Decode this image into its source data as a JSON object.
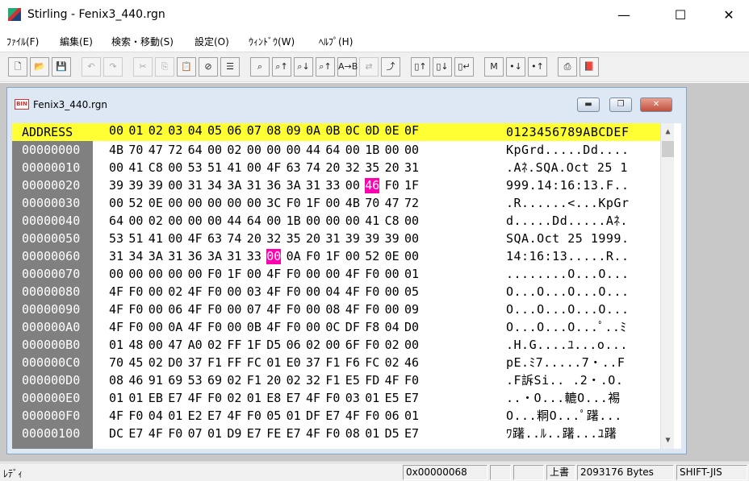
{
  "window": {
    "title": "Stirling - Fenix3_440.rgn",
    "minimize": "—",
    "maximize": "☐",
    "close": "✕"
  },
  "menu": [
    "ﾌｧｲﾙ(F)",
    "編集(E)",
    "検索・移動(S)",
    "設定(O)",
    "ｳｨﾝﾄﾞｳ(W)",
    "ﾍﾙﾌﾟ(H)"
  ],
  "toolbar": [
    {
      "name": "new-file",
      "g": "🗋",
      "d": false
    },
    {
      "name": "open",
      "g": "📂",
      "d": false
    },
    {
      "name": "save",
      "g": "💾",
      "d": false
    },
    {
      "name": "undo",
      "g": "↶",
      "d": true
    },
    {
      "name": "redo",
      "g": "↷",
      "d": true
    },
    {
      "name": "cut",
      "g": "✂",
      "d": true
    },
    {
      "name": "copy",
      "g": "⎘",
      "d": true
    },
    {
      "name": "paste",
      "g": "📋",
      "d": false
    },
    {
      "name": "delete",
      "g": "⊘",
      "d": false
    },
    {
      "name": "list",
      "g": "☰",
      "d": false
    },
    {
      "name": "find",
      "g": "⌕",
      "d": false
    },
    {
      "name": "find-next",
      "g": "⌕↑",
      "d": false
    },
    {
      "name": "find-down",
      "g": "⌕↓",
      "d": false
    },
    {
      "name": "find-up",
      "g": "⌕↑",
      "d": false
    },
    {
      "name": "replace",
      "g": "A→B",
      "d": false
    },
    {
      "name": "compare",
      "g": "⇄",
      "d": true
    },
    {
      "name": "goto",
      "g": "⤴",
      "d": false
    },
    {
      "name": "page-up",
      "g": "▯↑",
      "d": false
    },
    {
      "name": "page-down",
      "g": "▯↓",
      "d": false
    },
    {
      "name": "page-enter",
      "g": "▯↵",
      "d": false
    },
    {
      "name": "mark",
      "g": "M",
      "d": false
    },
    {
      "name": "mark-next",
      "g": "•↓",
      "d": false
    },
    {
      "name": "mark-prev",
      "g": "•↑",
      "d": false
    },
    {
      "name": "print",
      "g": "⎙",
      "d": false
    },
    {
      "name": "help",
      "g": "📕",
      "d": false
    }
  ],
  "document": {
    "title": "Fenix3_440.rgn",
    "icon_text": "BIN",
    "min": "▬",
    "restore": "❐",
    "close": "✕"
  },
  "hex": {
    "header_address": "ADDRESS",
    "header_cols": [
      "00",
      "01",
      "02",
      "03",
      "04",
      "05",
      "06",
      "07",
      "08",
      "09",
      "0A",
      "0B",
      "0C",
      "0D",
      "0E",
      "0F"
    ],
    "header_ascii": "0123456789ABCDEF",
    "rows": [
      {
        "addr": "00000000",
        "bytes": [
          "4B",
          "70",
          "47",
          "72",
          "64",
          "00",
          "02",
          "00",
          "00",
          "00",
          "44",
          "64",
          "00",
          "1B",
          "00",
          "00"
        ],
        "ascii": "KpGrd.....Dd...."
      },
      {
        "addr": "00000010",
        "bytes": [
          "00",
          "41",
          "C8",
          "00",
          "53",
          "51",
          "41",
          "00",
          "4F",
          "63",
          "74",
          "20",
          "32",
          "35",
          "20",
          "31"
        ],
        "ascii": ".Aﾈ.SQA.Oct 25 1"
      },
      {
        "addr": "00000020",
        "bytes": [
          "39",
          "39",
          "39",
          "00",
          "31",
          "34",
          "3A",
          "31",
          "36",
          "3A",
          "31",
          "33",
          "00",
          "46",
          "F0",
          "1F"
        ],
        "ascii": "999.14:16:13.F.."
      },
      {
        "addr": "00000030",
        "bytes": [
          "00",
          "52",
          "0E",
          "00",
          "00",
          "00",
          "00",
          "00",
          "3C",
          "F0",
          "1F",
          "00",
          "4B",
          "70",
          "47",
          "72"
        ],
        "ascii": ".R......<...KpGr"
      },
      {
        "addr": "00000040",
        "bytes": [
          "64",
          "00",
          "02",
          "00",
          "00",
          "00",
          "44",
          "64",
          "00",
          "1B",
          "00",
          "00",
          "00",
          "41",
          "C8",
          "00"
        ],
        "ascii": "d.....Dd.....Aﾈ."
      },
      {
        "addr": "00000050",
        "bytes": [
          "53",
          "51",
          "41",
          "00",
          "4F",
          "63",
          "74",
          "20",
          "32",
          "35",
          "20",
          "31",
          "39",
          "39",
          "39",
          "00"
        ],
        "ascii": "SQA.Oct 25 1999."
      },
      {
        "addr": "00000060",
        "bytes": [
          "31",
          "34",
          "3A",
          "31",
          "36",
          "3A",
          "31",
          "33",
          "00",
          "0A",
          "F0",
          "1F",
          "00",
          "52",
          "0E",
          "00"
        ],
        "ascii": "14:16:13.....R.."
      },
      {
        "addr": "00000070",
        "bytes": [
          "00",
          "00",
          "00",
          "00",
          "00",
          "F0",
          "1F",
          "00",
          "4F",
          "F0",
          "00",
          "00",
          "4F",
          "F0",
          "00",
          "01"
        ],
        "ascii": "........O...O..."
      },
      {
        "addr": "00000080",
        "bytes": [
          "4F",
          "F0",
          "00",
          "02",
          "4F",
          "F0",
          "00",
          "03",
          "4F",
          "F0",
          "00",
          "04",
          "4F",
          "F0",
          "00",
          "05"
        ],
        "ascii": "O...O...O...O..."
      },
      {
        "addr": "00000090",
        "bytes": [
          "4F",
          "F0",
          "00",
          "06",
          "4F",
          "F0",
          "00",
          "07",
          "4F",
          "F0",
          "00",
          "08",
          "4F",
          "F0",
          "00",
          "09"
        ],
        "ascii": "O...O...O...O..."
      },
      {
        "addr": "000000A0",
        "bytes": [
          "4F",
          "F0",
          "00",
          "0A",
          "4F",
          "F0",
          "00",
          "0B",
          "4F",
          "F0",
          "00",
          "0C",
          "DF",
          "F8",
          "04",
          "D0"
        ],
        "ascii": "O...O...O...ﾟ..ﾐ"
      },
      {
        "addr": "000000B0",
        "bytes": [
          "01",
          "48",
          "00",
          "47",
          "A0",
          "02",
          "FF",
          "1F",
          "D5",
          "06",
          "02",
          "00",
          "6F",
          "F0",
          "02",
          "00"
        ],
        "ascii": ".H.G....ﾕ...o..."
      },
      {
        "addr": "000000C0",
        "bytes": [
          "70",
          "45",
          "02",
          "D0",
          "37",
          "F1",
          "FF",
          "FC",
          "01",
          "E0",
          "37",
          "F1",
          "F6",
          "FC",
          "02",
          "46"
        ],
        "ascii": "pE.ﾐ7.....7・..F"
      },
      {
        "addr": "000000D0",
        "bytes": [
          "08",
          "46",
          "91",
          "69",
          "53",
          "69",
          "02",
          "F1",
          "20",
          "02",
          "32",
          "F1",
          "E5",
          "FD",
          "4F",
          "F0"
        ],
        "ascii": ".F訴Si.. .2・.O."
      },
      {
        "addr": "000000E0",
        "bytes": [
          "01",
          "01",
          "EB",
          "E7",
          "4F",
          "F0",
          "02",
          "01",
          "E8",
          "E7",
          "4F",
          "F0",
          "03",
          "01",
          "E5",
          "E7"
        ],
        "ascii": "..・O...轆O...裼"
      },
      {
        "addr": "000000F0",
        "bytes": [
          "4F",
          "F0",
          "04",
          "01",
          "E2",
          "E7",
          "4F",
          "F0",
          "05",
          "01",
          "DF",
          "E7",
          "4F",
          "F0",
          "06",
          "01"
        ],
        "ascii": "O...粡O...ﾟ躇..."
      },
      {
        "addr": "00000100",
        "bytes": [
          "DC",
          "E7",
          "4F",
          "F0",
          "07",
          "01",
          "D9",
          "E7",
          "FE",
          "E7",
          "4F",
          "F0",
          "08",
          "01",
          "D5",
          "E7"
        ],
        "ascii": "ﾜ躇..ﾙ..躇...ﾕ躇"
      }
    ],
    "highlights": [
      {
        "row": 2,
        "col": 13
      },
      {
        "row": 6,
        "col": 8
      }
    ]
  },
  "scrollbar": {
    "up": "▲",
    "down": "▼"
  },
  "status": {
    "ready": "ﾚﾃﾞｨ",
    "offset": "0x00000068",
    "mode": "上書",
    "size": "2093176 Bytes",
    "encoding": "SHIFT-JIS"
  }
}
